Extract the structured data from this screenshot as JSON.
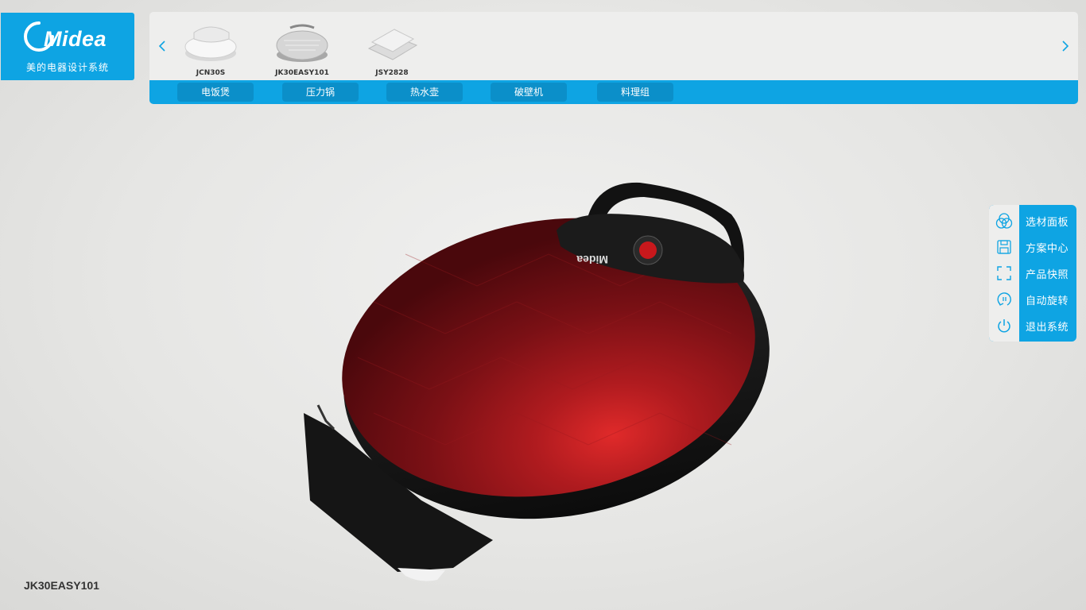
{
  "logo": {
    "brand": "Midea",
    "subtitle": "美的电器设计系统"
  },
  "colors": {
    "accent": "#0ea4e3",
    "accent_dark": "#0b8fc9",
    "product_red": "#8e1418"
  },
  "product_bar": {
    "prev_icon": "chevron-left-icon",
    "next_icon": "chevron-right-icon",
    "items": [
      {
        "label": "JCN30S"
      },
      {
        "label": "JK30EASY101"
      },
      {
        "label": "JSY2828"
      }
    ]
  },
  "categories": [
    {
      "label": "电饭煲"
    },
    {
      "label": "压力锅"
    },
    {
      "label": "热水壶"
    },
    {
      "label": "破壁机"
    },
    {
      "label": "料理组"
    }
  ],
  "side_menu": [
    {
      "label": "选材面板",
      "icon": "materials-icon"
    },
    {
      "label": "方案中心",
      "icon": "save-icon"
    },
    {
      "label": "产品快照",
      "icon": "snapshot-icon"
    },
    {
      "label": "自动旋转",
      "icon": "rotate-icon"
    },
    {
      "label": "退出系统",
      "icon": "power-icon"
    }
  ],
  "current_model": "JK30EASY101",
  "viewer": {
    "product_brand_mark": "Midea"
  }
}
